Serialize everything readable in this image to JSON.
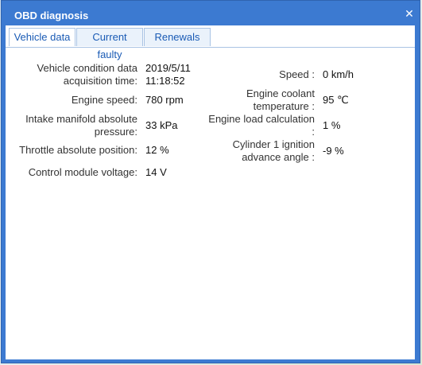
{
  "window": {
    "title": "OBD diagnosis",
    "close_glyph": "✕"
  },
  "tabs": [
    {
      "label": "Vehicle data",
      "active": true
    },
    {
      "label": "Current faulty",
      "active": false
    },
    {
      "label": "Renewals",
      "active": false
    }
  ],
  "fields": {
    "acq_time": {
      "label_line1": "Vehicle condition data",
      "label_line2": "acquisition time:",
      "value_line1": "2019/5/11",
      "value_line2": "11:18:52"
    },
    "speed": {
      "label": "Speed :",
      "value": "0 km/h"
    },
    "engine_speed": {
      "label": "Engine speed:",
      "value": "780 rpm"
    },
    "coolant": {
      "label_line1": "Engine coolant",
      "label_line2": "temperature :",
      "value": "95 ℃"
    },
    "intake": {
      "label_line1": "Intake manifold absolute",
      "label_line2": "pressure:",
      "value": "33 kPa"
    },
    "load": {
      "label_line1": "Engine load calculation",
      "label_line2": ":",
      "value": "1 %"
    },
    "throttle": {
      "label": "Throttle absolute position:",
      "value": "12 %"
    },
    "ignition": {
      "label_line1": "Cylinder 1 ignition",
      "label_line2": "advance angle :",
      "value": "-9 %"
    },
    "voltage": {
      "label": "Control module voltage:",
      "value": "14 V"
    }
  }
}
